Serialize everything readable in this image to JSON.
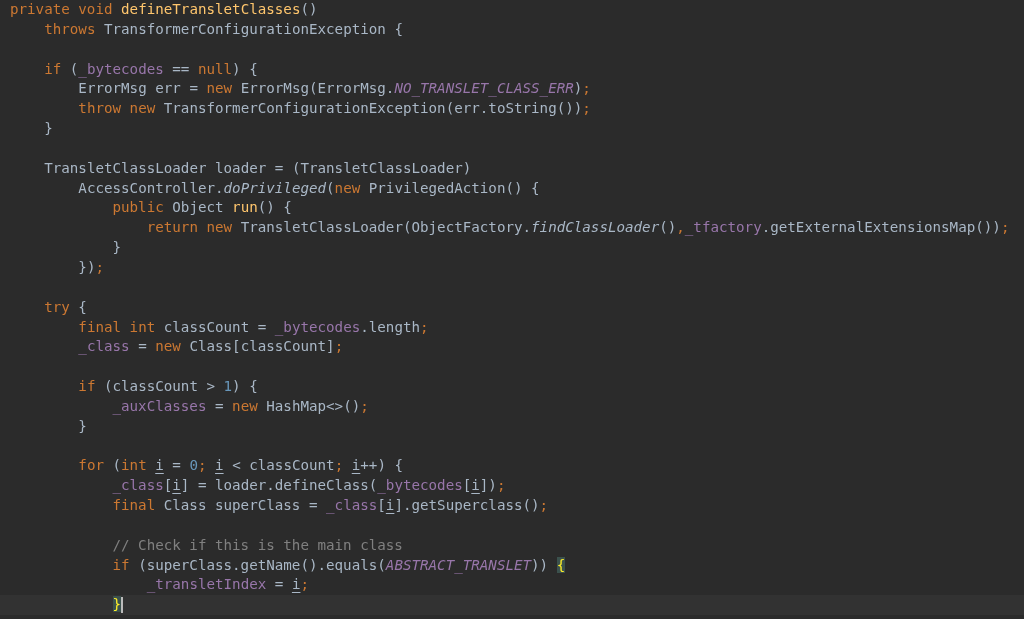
{
  "editor": {
    "lines": [
      {
        "current": false,
        "tokens": [
          {
            "kind": "kw",
            "text": "private void "
          },
          {
            "kind": "decl",
            "text": "defineTransletClasses"
          },
          {
            "kind": "plain",
            "text": "()"
          }
        ]
      },
      {
        "current": false,
        "tokens": [
          {
            "kind": "kw",
            "text": "    throws "
          },
          {
            "kind": "plain",
            "text": "TransformerConfigurationException {"
          }
        ]
      },
      {
        "current": false
      },
      {
        "current": false,
        "tokens": [
          {
            "kind": "kw",
            "text": "    if "
          },
          {
            "kind": "plain",
            "text": "("
          },
          {
            "kind": "field",
            "text": "_bytecodes"
          },
          {
            "kind": "plain",
            "text": " == "
          },
          {
            "kind": "kw",
            "text": "null"
          },
          {
            "kind": "plain",
            "text": ") {"
          }
        ]
      },
      {
        "current": false,
        "tokens": [
          {
            "kind": "plain",
            "text": "        ErrorMsg err = "
          },
          {
            "kind": "kw",
            "text": "new "
          },
          {
            "kind": "plain",
            "text": "ErrorMsg(ErrorMsg."
          },
          {
            "kind": "const",
            "text": "NO_TRANSLET_CLASS_ERR"
          },
          {
            "kind": "plain",
            "text": ")"
          },
          {
            "kind": "kw",
            "text": ";"
          }
        ]
      },
      {
        "current": false,
        "tokens": [
          {
            "kind": "kw",
            "text": "        throw new "
          },
          {
            "kind": "plain",
            "text": "TransformerConfigurationException(err.toString())"
          },
          {
            "kind": "kw",
            "text": ";"
          }
        ]
      },
      {
        "current": false,
        "tokens": [
          {
            "kind": "plain",
            "text": "    }"
          }
        ]
      },
      {
        "current": false
      },
      {
        "current": false,
        "tokens": [
          {
            "kind": "plain",
            "text": "    TransletClassLoader loader = (TransletClassLoader)"
          }
        ]
      },
      {
        "current": false,
        "tokens": [
          {
            "kind": "plain",
            "text": "        AccessController."
          },
          {
            "kind": "static",
            "text": "doPrivileged"
          },
          {
            "kind": "plain",
            "text": "("
          },
          {
            "kind": "kw",
            "text": "new "
          },
          {
            "kind": "plain",
            "text": "PrivilegedAction() {"
          }
        ]
      },
      {
        "current": false,
        "tokens": [
          {
            "kind": "kw",
            "text": "            public "
          },
          {
            "kind": "plain",
            "text": "Object "
          },
          {
            "kind": "decl",
            "text": "run"
          },
          {
            "kind": "plain",
            "text": "() {"
          }
        ]
      },
      {
        "current": false,
        "tokens": [
          {
            "kind": "kw",
            "text": "                return new "
          },
          {
            "kind": "plain",
            "text": "TransletClassLoader(ObjectFactory."
          },
          {
            "kind": "static",
            "text": "findClassLoader"
          },
          {
            "kind": "plain",
            "text": "()"
          },
          {
            "kind": "kw",
            "text": ","
          },
          {
            "kind": "field",
            "text": "_tfactory"
          },
          {
            "kind": "plain",
            "text": ".getExternalExtensionsMap())"
          },
          {
            "kind": "kw",
            "text": ";"
          }
        ]
      },
      {
        "current": false,
        "tokens": [
          {
            "kind": "plain",
            "text": "            }"
          }
        ]
      },
      {
        "current": false,
        "tokens": [
          {
            "kind": "plain",
            "text": "        })"
          },
          {
            "kind": "kw",
            "text": ";"
          }
        ]
      },
      {
        "current": false
      },
      {
        "current": false,
        "tokens": [
          {
            "kind": "kw",
            "text": "    try "
          },
          {
            "kind": "plain",
            "text": "{"
          }
        ]
      },
      {
        "current": false,
        "tokens": [
          {
            "kind": "kw",
            "text": "        final int "
          },
          {
            "kind": "plain",
            "text": "classCount = "
          },
          {
            "kind": "field",
            "text": "_bytecodes"
          },
          {
            "kind": "plain",
            "text": ".length"
          },
          {
            "kind": "kw",
            "text": ";"
          }
        ]
      },
      {
        "current": false,
        "tokens": [
          {
            "kind": "field",
            "text": "        _class"
          },
          {
            "kind": "plain",
            "text": " = "
          },
          {
            "kind": "kw",
            "text": "new "
          },
          {
            "kind": "plain",
            "text": "Class[classCount]"
          },
          {
            "kind": "kw",
            "text": ";"
          }
        ]
      },
      {
        "current": false
      },
      {
        "current": false,
        "tokens": [
          {
            "kind": "kw",
            "text": "        if "
          },
          {
            "kind": "plain",
            "text": "(classCount > "
          },
          {
            "kind": "num",
            "text": "1"
          },
          {
            "kind": "plain",
            "text": ") {"
          }
        ]
      },
      {
        "current": false,
        "tokens": [
          {
            "kind": "field",
            "text": "            _auxClasses"
          },
          {
            "kind": "plain",
            "text": " = "
          },
          {
            "kind": "kw",
            "text": "new "
          },
          {
            "kind": "plain",
            "text": "HashMap<>()"
          },
          {
            "kind": "kw",
            "text": ";"
          }
        ]
      },
      {
        "current": false,
        "tokens": [
          {
            "kind": "plain",
            "text": "        }"
          }
        ]
      },
      {
        "current": false
      },
      {
        "current": false,
        "tokens": [
          {
            "kind": "kw",
            "text": "        for "
          },
          {
            "kind": "plain",
            "text": "("
          },
          {
            "kind": "kw",
            "text": "int "
          },
          {
            "kind": "var",
            "text": "i"
          },
          {
            "kind": "plain",
            "text": " = "
          },
          {
            "kind": "num",
            "text": "0"
          },
          {
            "kind": "kw",
            "text": "; "
          },
          {
            "kind": "var",
            "text": "i"
          },
          {
            "kind": "plain",
            "text": " < classCount"
          },
          {
            "kind": "kw",
            "text": "; "
          },
          {
            "kind": "var",
            "text": "i"
          },
          {
            "kind": "plain",
            "text": "++) {"
          }
        ]
      },
      {
        "current": false,
        "tokens": [
          {
            "kind": "field",
            "text": "            _class"
          },
          {
            "kind": "plain",
            "text": "["
          },
          {
            "kind": "var",
            "text": "i"
          },
          {
            "kind": "plain",
            "text": "] = loader.defineClass("
          },
          {
            "kind": "field",
            "text": "_bytecodes"
          },
          {
            "kind": "plain",
            "text": "["
          },
          {
            "kind": "var",
            "text": "i"
          },
          {
            "kind": "plain",
            "text": "])"
          },
          {
            "kind": "kw",
            "text": ";"
          }
        ]
      },
      {
        "current": false,
        "tokens": [
          {
            "kind": "kw",
            "text": "            final "
          },
          {
            "kind": "plain",
            "text": "Class superClass = "
          },
          {
            "kind": "field",
            "text": "_class"
          },
          {
            "kind": "plain",
            "text": "["
          },
          {
            "kind": "var",
            "text": "i"
          },
          {
            "kind": "plain",
            "text": "].getSuperclass()"
          },
          {
            "kind": "kw",
            "text": ";"
          }
        ]
      },
      {
        "current": false
      },
      {
        "current": false,
        "tokens": [
          {
            "kind": "comment",
            "text": "            // Check if this is the main class"
          }
        ]
      },
      {
        "current": false,
        "tokens": [
          {
            "kind": "kw",
            "text": "            if "
          },
          {
            "kind": "plain",
            "text": "(superClass.getName().equals("
          },
          {
            "kind": "const",
            "text": "ABSTRACT_TRANSLET"
          },
          {
            "kind": "plain",
            "text": ")) "
          },
          {
            "kind": "brace",
            "text": "{"
          }
        ]
      },
      {
        "current": false,
        "tokens": [
          {
            "kind": "field",
            "text": "                _transletIndex"
          },
          {
            "kind": "plain",
            "text": " = "
          },
          {
            "kind": "var",
            "text": "i"
          },
          {
            "kind": "kw",
            "text": ";"
          }
        ]
      },
      {
        "current": true,
        "tokens": [
          {
            "kind": "brace",
            "text": "            }"
          }
        ]
      }
    ]
  }
}
